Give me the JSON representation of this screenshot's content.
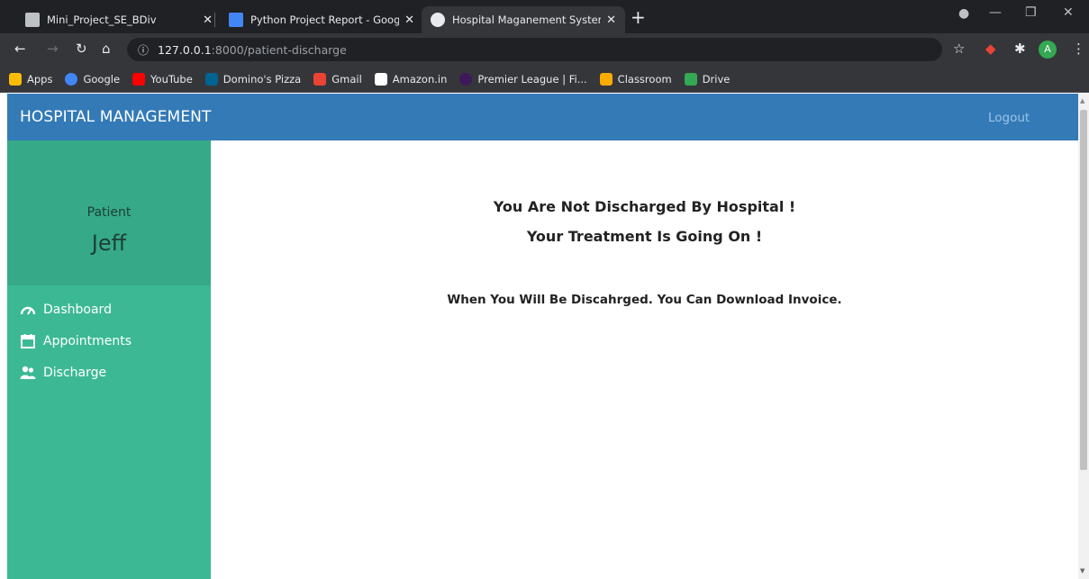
{
  "browser": {
    "tabs": [
      {
        "title": "Mini_Project_SE_BDiv",
        "active": false
      },
      {
        "title": "Python Project Report - Google D",
        "active": false
      },
      {
        "title": "Hospital Maganement System",
        "active": true
      }
    ],
    "url_host": "127.0.0.1",
    "url_path": ":8000/patient-discharge",
    "bookmarks": [
      {
        "label": "Apps",
        "color": "#fbbc04"
      },
      {
        "label": "Google",
        "color": "#4285f4"
      },
      {
        "label": "YouTube",
        "color": "#ff0000"
      },
      {
        "label": "Domino's Pizza",
        "color": "#006491"
      },
      {
        "label": "Gmail",
        "color": "#ea4335"
      },
      {
        "label": "Amazon.in",
        "color": "#ffffff"
      },
      {
        "label": "Premier League | Fi...",
        "color": "#3d195b"
      },
      {
        "label": "Classroom",
        "color": "#f9ab00"
      },
      {
        "label": "Drive",
        "color": "#34a853"
      }
    ],
    "profile_initial": "A"
  },
  "navbar": {
    "brand": "HOSPITAL MANAGEMENT",
    "logout_label": "Logout",
    "color": "#337ab7"
  },
  "sidebar": {
    "role": "Patient",
    "user_name": "Jeff",
    "color": "#3cb994",
    "items": [
      {
        "label": "Dashboard",
        "icon": "dashboard-gauge-icon"
      },
      {
        "label": "Appointments",
        "icon": "calendar-icon"
      },
      {
        "label": "Discharge",
        "icon": "users-icon"
      }
    ]
  },
  "main": {
    "heading_line1": "You Are Not Discharged By Hospital !",
    "heading_line2": "Your Treatment Is Going On !",
    "note": "When You Will Be Discahrged. You Can Download Invoice."
  }
}
